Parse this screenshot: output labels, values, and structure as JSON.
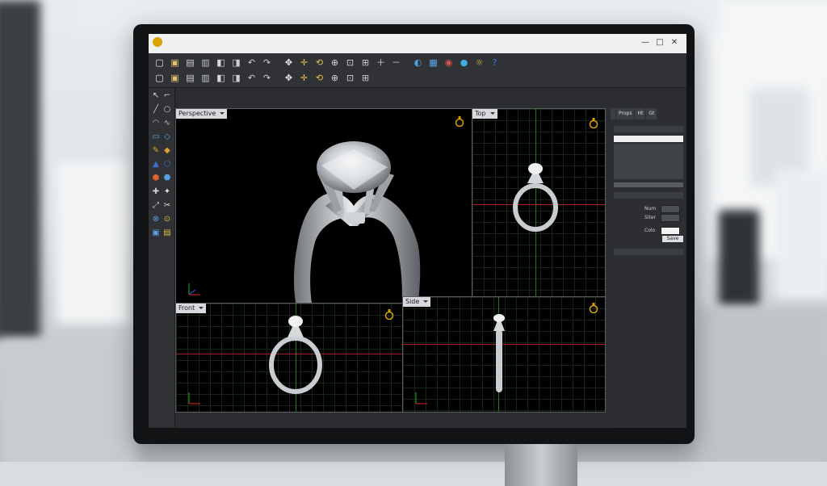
{
  "app": {
    "titlebar_buttons": [
      "—",
      "□",
      "✕"
    ]
  },
  "toolbar": {
    "row1_icons": [
      "new-icon",
      "open-icon",
      "save-icon",
      "print-icon",
      "copy-icon",
      "paste-icon",
      "undo-icon",
      "redo-icon",
      "pan-icon",
      "move-icon",
      "rotate-icon",
      "zoom-icon",
      "zoom-window-icon",
      "zoom-extents-icon",
      "zoom-in-icon",
      "zoom-out-icon",
      "display-icon",
      "grid-icon",
      "render-icon",
      "material-icon",
      "light-icon",
      "help-icon"
    ],
    "row2_icons": [
      "shade-icon",
      "wireframe-icon",
      "select-icon",
      "point-icon",
      "curve-icon",
      "surface-icon",
      "solid-icon",
      "mesh-icon",
      "transform-icon",
      "array-icon",
      "boolean-icon",
      "fillet-icon",
      "dimension-icon",
      "layer-icon"
    ]
  },
  "viewports": {
    "perspective": {
      "label": "Perspective"
    },
    "top": {
      "label": "Top"
    },
    "front": {
      "label": "Front"
    },
    "side": {
      "label": "Side"
    }
  },
  "right_panel": {
    "tabs": [
      "",
      "Props",
      "Ht",
      "Gt"
    ],
    "labels": {
      "row_a": "Num",
      "row_b": "Siter",
      "color": "Colo",
      "button": "Save"
    }
  },
  "colors": {
    "accent": "#d9a400",
    "metal": "#c9ccd0",
    "axis_x": "#a32020",
    "axis_y": "#1c7a1c"
  }
}
